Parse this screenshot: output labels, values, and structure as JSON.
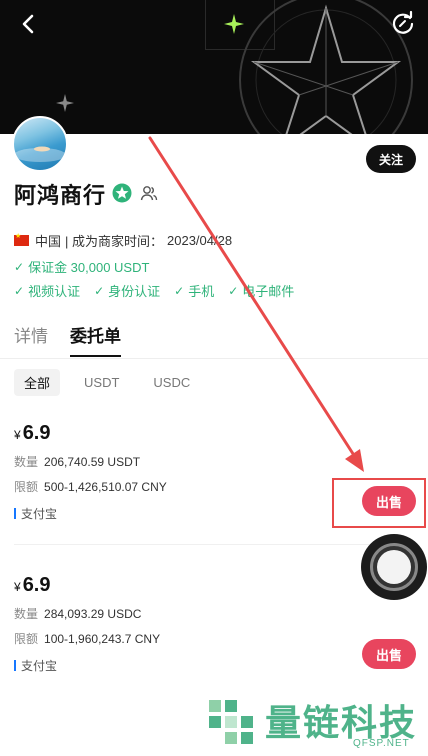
{
  "merchant": {
    "name": "阿鸿商行",
    "follow_label": "关注",
    "country": "中国",
    "since_label": "| 成为商家时间：",
    "since_date": "2023/04/28",
    "deposit": "保证金 30,000 USDT",
    "verifications": [
      "视频认证",
      "身份认证",
      "手机",
      "电子邮件"
    ]
  },
  "tabs": [
    {
      "label": "详情",
      "active": false
    },
    {
      "label": "委托单",
      "active": true
    }
  ],
  "filters": [
    {
      "label": "全部",
      "active": true
    },
    {
      "label": "USDT",
      "active": false
    },
    {
      "label": "USDC",
      "active": false
    }
  ],
  "orders": [
    {
      "currency_symbol": "¥",
      "price": "6.9",
      "quantity_label": "数量",
      "quantity": "206,740.59 USDT",
      "limit_label": "限额",
      "limit": "500-1,426,510.07 CNY",
      "payment": "支付宝",
      "action": "出售"
    },
    {
      "currency_symbol": "¥",
      "price": "6.9",
      "quantity_label": "数量",
      "quantity": "284,093.29 USDC",
      "limit_label": "限额",
      "limit": "100-1,960,243.7 CNY",
      "payment": "支付宝",
      "action": "出售"
    }
  ],
  "watermark": {
    "text": "量链科技",
    "sub": "QFSP.NET"
  },
  "colors": {
    "accent_green": "#2fb37a",
    "sell_red": "#e8455e",
    "annotation_red": "#e84a4a",
    "banner_bg": "#0b0b0b"
  }
}
